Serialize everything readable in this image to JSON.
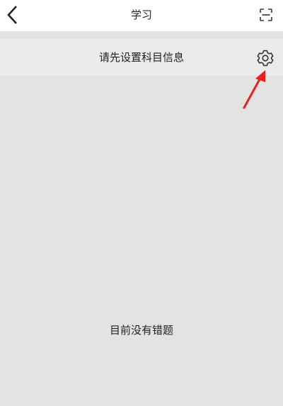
{
  "header": {
    "title": "学习",
    "back_icon": "chevron-left-icon",
    "scan_icon": "scan-icon"
  },
  "subject_bar": {
    "prompt": "请先设置科目信息",
    "settings_icon": "gear-icon"
  },
  "content": {
    "empty_message": "目前没有错题"
  },
  "annotation": {
    "arrow_color": "#e8201f",
    "arrow_icon": "red-arrow-pointer"
  }
}
